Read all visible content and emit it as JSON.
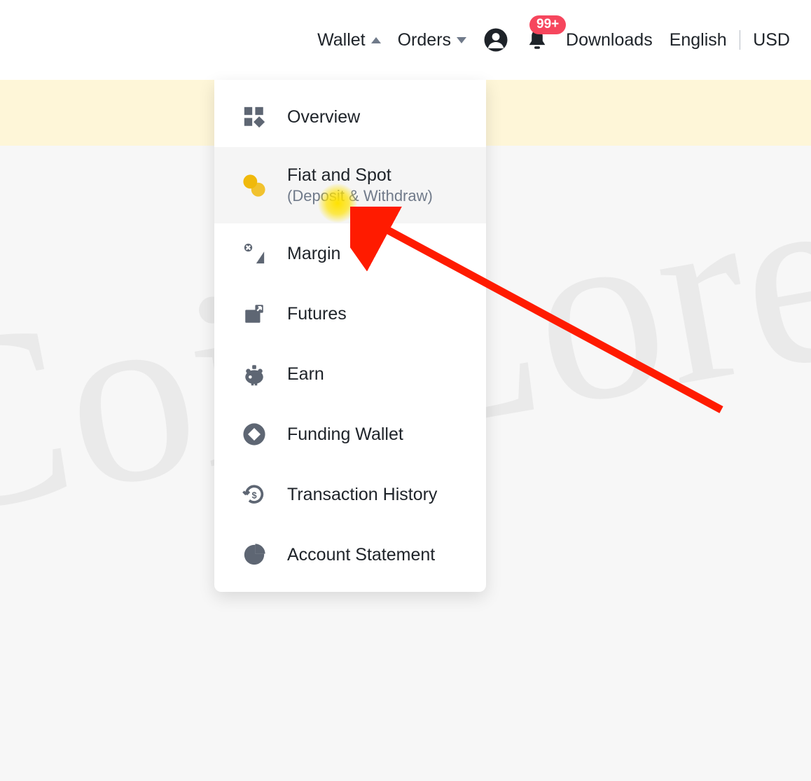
{
  "topnav": {
    "wallet": "Wallet",
    "orders": "Orders",
    "downloads": "Downloads",
    "language": "English",
    "currency": "USD",
    "notification_badge": "99+"
  },
  "wallet_menu": {
    "items": [
      {
        "label": "Overview",
        "sub": ""
      },
      {
        "label": "Fiat and Spot",
        "sub": "(Deposit & Withdraw)"
      },
      {
        "label": "Margin",
        "sub": ""
      },
      {
        "label": "Futures",
        "sub": ""
      },
      {
        "label": "Earn",
        "sub": ""
      },
      {
        "label": "Funding Wallet",
        "sub": ""
      },
      {
        "label": "Transaction History",
        "sub": ""
      },
      {
        "label": "Account Statement",
        "sub": ""
      }
    ]
  },
  "watermark_text": "CoinLore"
}
